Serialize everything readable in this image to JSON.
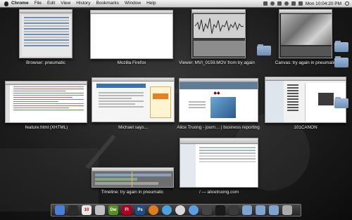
{
  "menubar": {
    "app": "Chrome",
    "items": [
      "File",
      "Edit",
      "View",
      "History",
      "Bookmarks",
      "Window",
      "Help"
    ],
    "clock": "Mon 10:04:20 PM",
    "colors": {
      "bar": "#d9d9d9",
      "text": "#111111"
    }
  },
  "windows": [
    {
      "id": "browser-pneumatic",
      "caption": "Browser: pneumatic"
    },
    {
      "id": "mozilla-firefox",
      "caption": "Mozilla Firefox"
    },
    {
      "id": "viewer-mvi",
      "caption": "Viewer: MVI_0159.MOV from try again"
    },
    {
      "id": "canvas",
      "caption": "Canvas: try again in pneumatic"
    },
    {
      "id": "feature-html",
      "caption": "feature.html (XHTML)"
    },
    {
      "id": "michael-says",
      "caption": "Michael says..."
    },
    {
      "id": "alice-truong",
      "caption": "Alice Truong - journ… | business reporting"
    },
    {
      "id": "101canon",
      "caption": "101CANON"
    },
    {
      "id": "timeline",
      "caption": "Timeline: try again in pneumatic"
    },
    {
      "id": "alicetruong-com",
      "caption": "/ — alicetruong.com"
    }
  ],
  "dock": {
    "icons": [
      {
        "name": "finder-icon",
        "color": "#4a7fd6"
      },
      {
        "name": "dashboard-icon",
        "color": "#2b2b2b"
      },
      {
        "name": "calendar-icon",
        "color": "#e8e8e8",
        "text": "10"
      },
      {
        "name": "mail-icon",
        "color": "#c0c0c0"
      },
      {
        "name": "dreamweaver-icon",
        "color": "#5a8f1e",
        "text": "Dw"
      },
      {
        "name": "flash-icon",
        "color": "#b0001f",
        "text": "Fl"
      },
      {
        "name": "photoshop-icon",
        "color": "#1d4f86",
        "text": "Ps"
      },
      {
        "name": "firefox-icon",
        "color": "#e07b20"
      },
      {
        "name": "safari-icon",
        "color": "#4aa3e0"
      },
      {
        "name": "chrome-icon",
        "color": "#d9d9d9"
      },
      {
        "name": "itunes-icon",
        "color": "#5aa0e0"
      },
      {
        "name": "final-cut-icon",
        "color": "#444444"
      },
      {
        "name": "terminal-icon",
        "color": "#1a1a1a"
      },
      {
        "name": "clapper-icon",
        "color": "#3a3a3a"
      },
      {
        "name": "downloads-folder-icon",
        "color": "#7fa2cf"
      },
      {
        "name": "documents-folder-icon",
        "color": "#7fa2cf"
      },
      {
        "name": "applications-folder-icon",
        "color": "#7fa2cf"
      },
      {
        "name": "trash-icon",
        "color": "#aaaaaa"
      }
    ]
  }
}
